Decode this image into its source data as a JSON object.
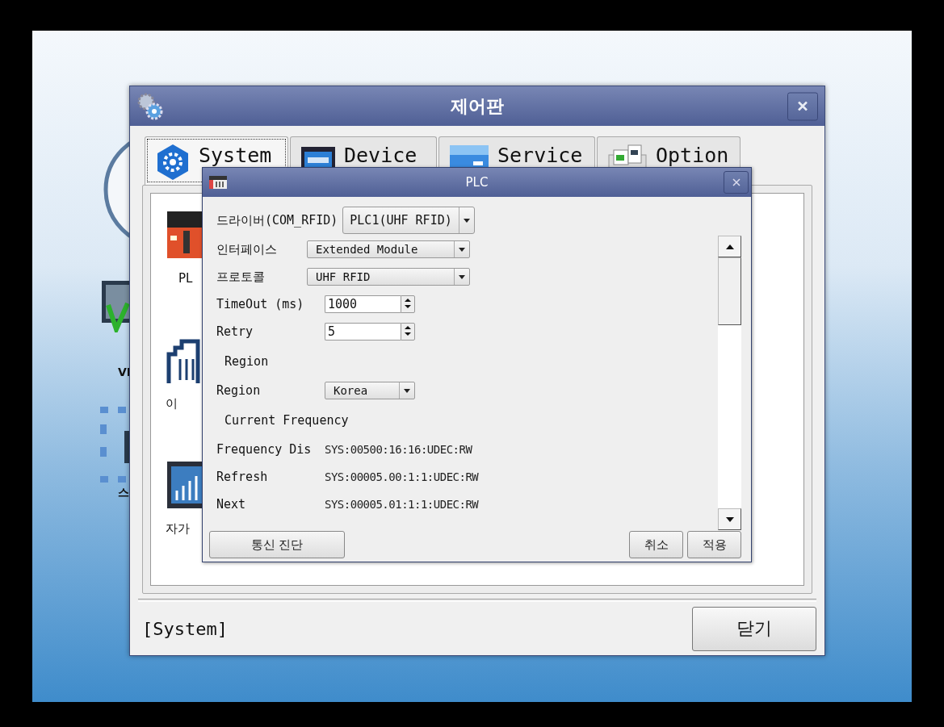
{
  "desktop": {
    "icon_labels": [
      "VI",
      "스"
    ]
  },
  "control_panel": {
    "title": "제어판",
    "tabs": [
      {
        "label": "System",
        "selected": true
      },
      {
        "label": "Device",
        "selected": false
      },
      {
        "label": "Service",
        "selected": false
      },
      {
        "label": "Option",
        "selected": false
      }
    ],
    "items": [
      {
        "label": "PL"
      },
      {
        "label": "이"
      },
      {
        "label": "자가"
      }
    ],
    "section": "[System]",
    "close_button": "닫기"
  },
  "plc_dialog": {
    "title": "PLC",
    "driver": {
      "label": "드라이버(COM_RFID)",
      "value": "PLC1(UHF RFID)"
    },
    "rows": [
      {
        "kind": "select",
        "label": "인터페이스",
        "value": "Extended Module"
      },
      {
        "kind": "select",
        "label": "프로토콜",
        "value": "UHF RFID"
      },
      {
        "kind": "spin",
        "label": "TimeOut (ms)",
        "value": "1000"
      },
      {
        "kind": "spin",
        "label": "Retry",
        "value": "5"
      },
      {
        "kind": "header",
        "label": "Region"
      },
      {
        "kind": "combo",
        "label": "Region",
        "value": "Korea"
      },
      {
        "kind": "header",
        "label": "Current Frequency"
      },
      {
        "kind": "text",
        "label": "Frequency Dis",
        "value": "SYS:00500:16:16:UDEC:RW"
      },
      {
        "kind": "text",
        "label": "Refresh",
        "value": "SYS:00005.00:1:1:UDEC:RW"
      },
      {
        "kind": "text",
        "label": "Next",
        "value": "SYS:00005.01:1:1:UDEC:RW"
      }
    ],
    "diagnose_button": "통신 진단",
    "cancel_button": "취소",
    "apply_button": "적용"
  }
}
